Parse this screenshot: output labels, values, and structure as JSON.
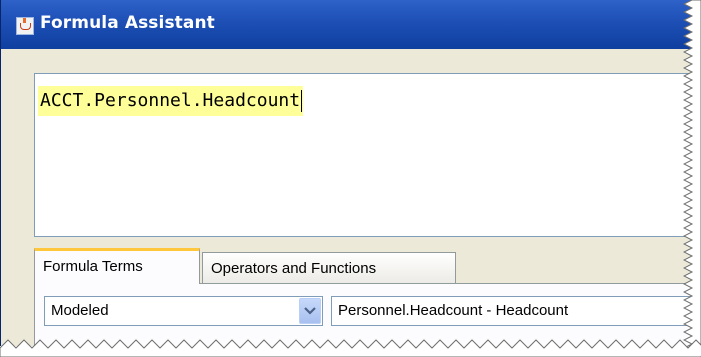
{
  "window": {
    "title": "Formula Assistant",
    "title_icon": "java-cup-icon"
  },
  "formula": {
    "text": "ACCT.Personnel.Headcount",
    "highlight_color": "#ffff99"
  },
  "tabs": [
    {
      "label": "Formula Terms",
      "active": true
    },
    {
      "label": "Operators and Functions",
      "active": false
    }
  ],
  "term_type_select": {
    "selected": "Modeled",
    "button_icon": "chevron-down-icon"
  },
  "term_field": {
    "value": "Personnel.Headcount - Headcount"
  },
  "colors": {
    "titlebar": "#1d4fb5",
    "active_tab_accent": "#ffc83c",
    "window_bg": "#ece9d8"
  }
}
